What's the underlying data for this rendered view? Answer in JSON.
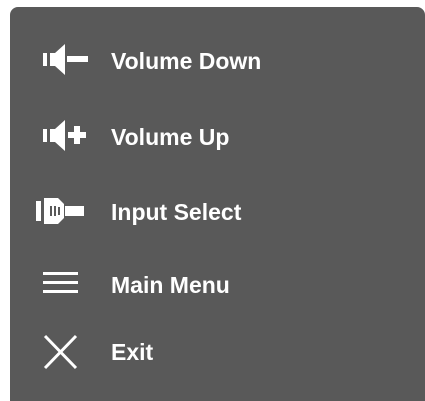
{
  "menu": {
    "items": [
      {
        "label": "Volume Down",
        "icon": "volume-down-icon"
      },
      {
        "label": "Volume Up",
        "icon": "volume-up-icon"
      },
      {
        "label": "Input Select",
        "icon": "input-select-icon"
      },
      {
        "label": "Main Menu",
        "icon": "menu-icon"
      },
      {
        "label": "Exit",
        "icon": "close-icon"
      }
    ]
  },
  "colors": {
    "panel_background": "#595959",
    "foreground": "#ffffff",
    "page_background": "#ffffff"
  }
}
